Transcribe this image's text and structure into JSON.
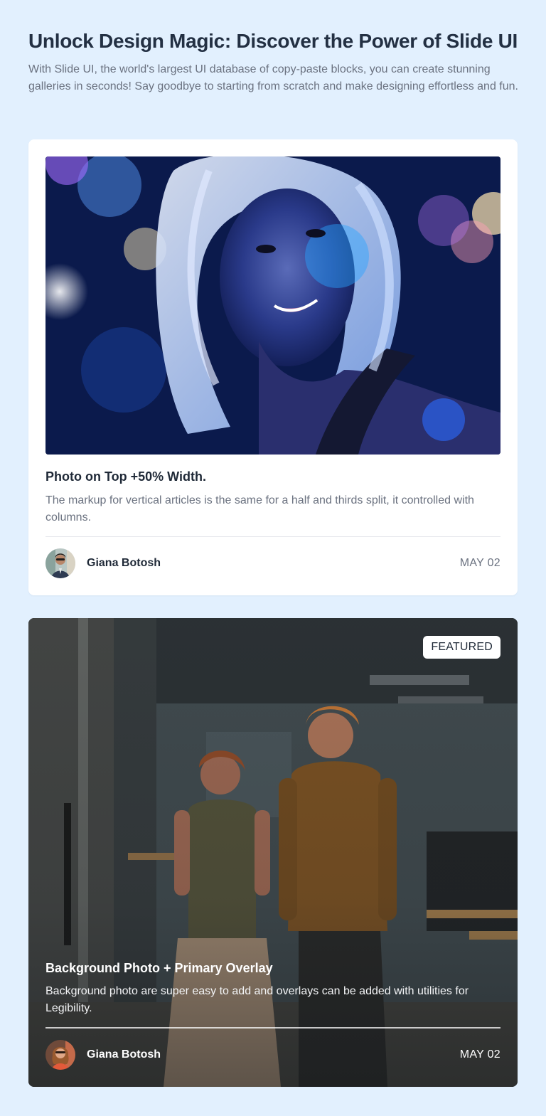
{
  "header": {
    "title": "Unlock Design Magic: Discover the Power of Slide UI",
    "subtitle": "With Slide UI, the world's largest UI database of copy-paste blocks, you can create stunning galleries in seconds! Say goodbye to starting from scratch and make designing effortless and fun."
  },
  "cards": [
    {
      "title": "Photo on Top +50% Width.",
      "description": "The markup for vertical articles is the same for a half and thirds split, it controlled with columns.",
      "author": "Giana Botosh",
      "date": "MAY 02"
    },
    {
      "badge": "FEATURED",
      "title": "Background Photo + Primary Overlay",
      "description": "Background photo are super easy to add and overlays can be added with utilities for Legibility.",
      "author": "Giana Botosh",
      "date": "MAY 02"
    }
  ],
  "colors": {
    "page_background": "#e2f0fe",
    "card_background": "#ffffff",
    "heading": "#233043",
    "muted_text": "#6b7280"
  }
}
